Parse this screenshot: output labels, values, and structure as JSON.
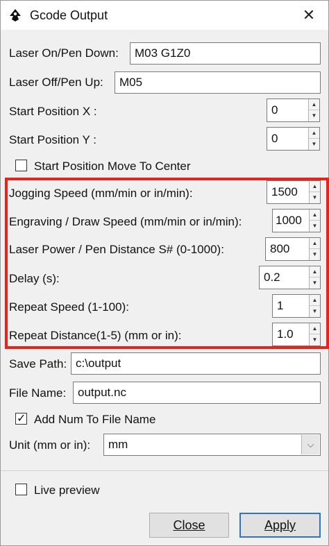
{
  "window": {
    "title": "Gcode Output",
    "close_glyph": "✕",
    "icon": "inkscape-app-icon"
  },
  "fields": {
    "laser_on": {
      "label": "Laser On/Pen Down:",
      "value": "M03 G1Z0"
    },
    "laser_off": {
      "label": "Laser Off/Pen Up:",
      "value": "M05"
    },
    "start_x": {
      "label": "Start Position X :",
      "value": "0"
    },
    "start_y": {
      "label": "Start Position Y :",
      "value": "0"
    },
    "move_center": {
      "label": "Start Position Move To Center",
      "checked": false
    },
    "jogging_speed": {
      "label": "Jogging Speed (mm/min or in/min):",
      "value": "1500"
    },
    "engraving_speed": {
      "label": "Engraving / Draw Speed (mm/min or in/min):",
      "value": "1000"
    },
    "laser_power": {
      "label": "Laser Power / Pen Distance S# (0-1000):",
      "value": "800"
    },
    "delay": {
      "label": "Delay (s):",
      "value": "0.2"
    },
    "repeat_speed": {
      "label": "Repeat Speed (1-100):",
      "value": "1"
    },
    "repeat_distance": {
      "label": "Repeat Distance(1-5) (mm or in):",
      "value": "1.0"
    },
    "save_path": {
      "label": "Save Path:",
      "value": "c:\\output"
    },
    "file_name": {
      "label": "File Name:",
      "value": "output.nc"
    },
    "add_num": {
      "label": "Add Num To File Name",
      "checked": true
    },
    "unit": {
      "label": "Unit (mm or in):",
      "value": "mm"
    },
    "live_preview": {
      "label": "Live preview",
      "checked": false
    }
  },
  "spin_glyphs": {
    "up": "▲",
    "down": "▼"
  },
  "combo_glyph": "⌵",
  "check_glyph": "✓",
  "buttons": {
    "close": {
      "label": "Close"
    },
    "apply": {
      "label": "Apply"
    }
  },
  "colors": {
    "highlight_border": "#e8231e",
    "default_button_border": "#2a74d0",
    "background": "#f0f0f0"
  }
}
